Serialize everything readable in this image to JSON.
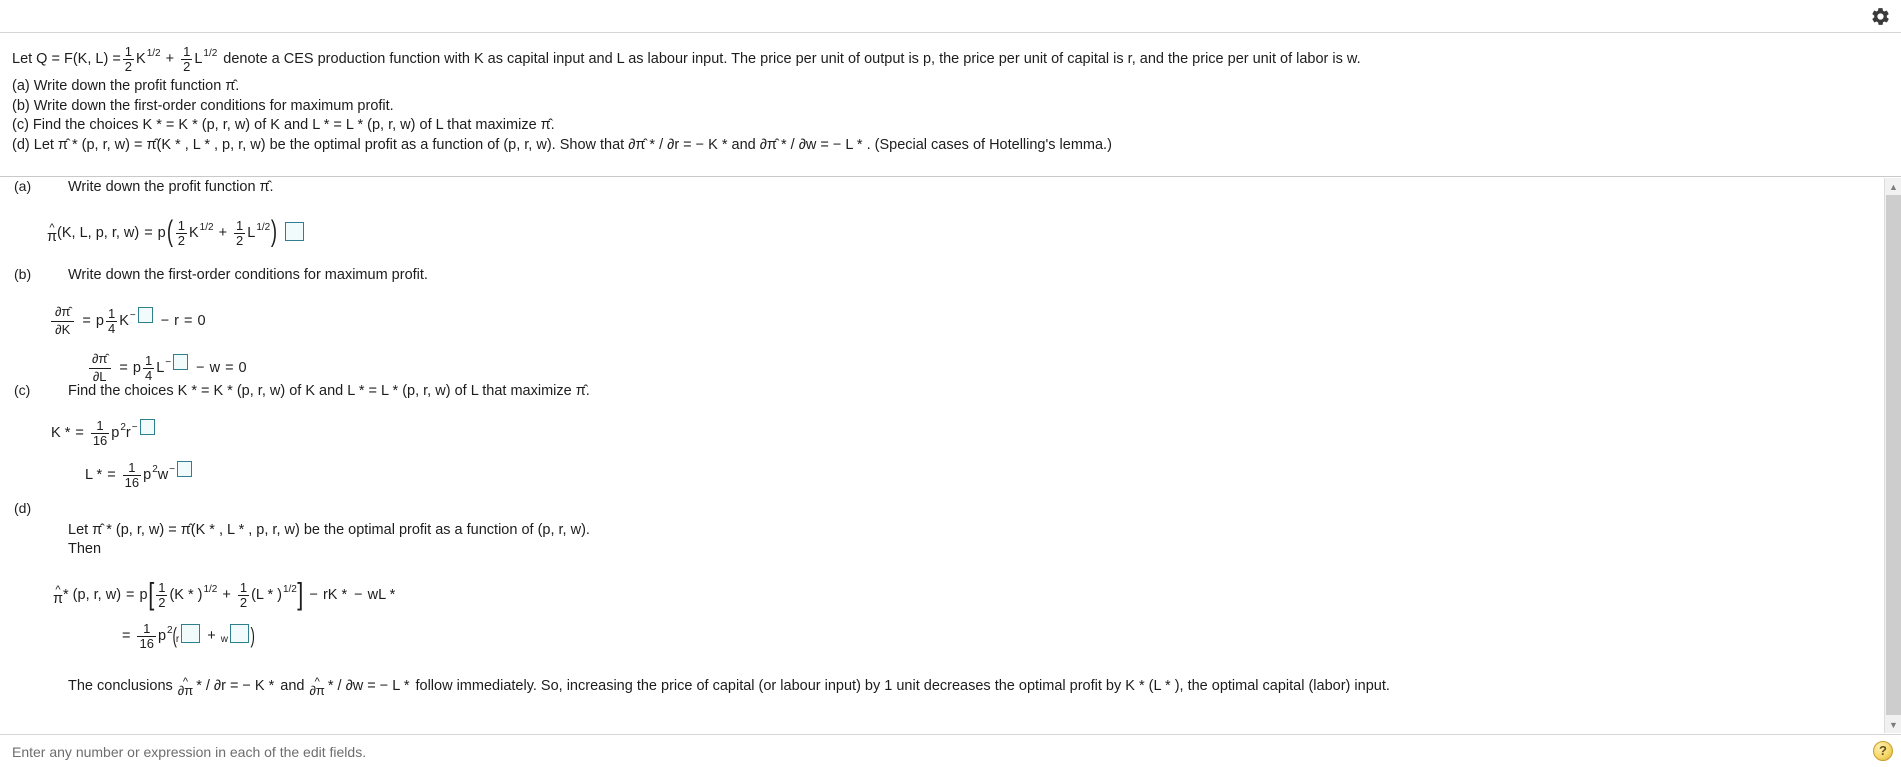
{
  "topbar": {
    "settings_icon": "gear-icon"
  },
  "statement": {
    "lead_prefix": "Let Q  =  F(K, L)  =",
    "lead_frac1_num": "1",
    "lead_frac1_den": "2",
    "lead_var1": "K",
    "lead_exp1": "1/2",
    "lead_plus": "+",
    "lead_frac2_num": "1",
    "lead_frac2_den": "2",
    "lead_var2": "L",
    "lead_exp2": "1/2",
    "lead_suffix": "denote a CES production function with K as capital input and L as labour input. The price per unit of output is p, the price per unit of capital is r, and the price per unit of labor is w.",
    "items": [
      "(a) Write down the profit function π̂.",
      "(b) Write down the first-order conditions for maximum profit.",
      "(c) Find the choices K *  = K * (p, r, w) of K and L *  = L * (p, r, w) of L that maximize π̂.",
      "(d) Let π̂ * (p, r, w) = π̂(K * , L * , p, r, w) be the optimal profit as a function of (p, r, w). Show that ∂π̂ * / ∂r  =  − K *  and ∂π̂ * / ∂w  =  − L * . (Special cases of Hotelling's lemma.)"
    ]
  },
  "parts": {
    "a": {
      "label": "(a)",
      "prompt": "Write down the profit function π̂.",
      "eq": {
        "lhs_pi": "π̂",
        "lhs_args": "(K, L, p, r, w)",
        "equals": "=",
        "p": "p",
        "open_paren": "(",
        "f1_num": "1",
        "f1_den": "2",
        "v1": "K",
        "e1": "1/2",
        "plus": "+",
        "f2_num": "1",
        "f2_den": "2",
        "v2": "L",
        "e2": "1/2",
        "close_paren": ")",
        "box_value": ""
      }
    },
    "b": {
      "label": "(b)",
      "prompt": "Write down the first-order conditions for maximum profit.",
      "eq1": {
        "dnum": "∂π̂",
        "dden": "∂K",
        "equals": "=",
        "p": "p",
        "f_num": "1",
        "f_den": "4",
        "v": "K",
        "minus_exp": "−",
        "box_value": "",
        "minus": "−",
        "term": "r",
        "equals2": "=",
        "zero": "0"
      },
      "eq2": {
        "dnum": "∂π̂",
        "dden": "∂L",
        "equals": "=",
        "p": "p",
        "f_num": "1",
        "f_den": "4",
        "v": "L",
        "minus_exp": "−",
        "box_value": "",
        "minus": "−",
        "term": "w",
        "equals2": "=",
        "zero": "0"
      }
    },
    "c": {
      "label": "(c)",
      "prompt": "Find the choices K *  = K * (p, r, w) of K and L *  = L * (p, r, w) of L that maximize π̂.",
      "eq1": {
        "lhs": "K *",
        "equals": "=",
        "f_num": "1",
        "f_den": "16",
        "p": "p",
        "p_exp": "2",
        "v": "r",
        "minus_exp": "−",
        "box_value": ""
      },
      "eq2": {
        "lhs": "L *",
        "equals": "=",
        "f_num": "1",
        "f_den": "16",
        "p": "p",
        "p_exp": "2",
        "v": "w",
        "minus_exp": "−",
        "box_value": ""
      }
    },
    "d": {
      "label": "(d)",
      "prompt_line1": "Let π̂ * (p, r, w) = π̂(K * , L * , p, r, w) be the optimal profit as a function of (p, r, w).",
      "prompt_line2": "Then",
      "eq1": {
        "lhs_pi": "π̂",
        "lhs_args": "* (p, r, w)",
        "equals": "=",
        "p": "p",
        "open_brack": "[",
        "f1_num": "1",
        "f1_den": "2",
        "t1": "(K * )",
        "e1": "1/2",
        "plus": "+",
        "f2_num": "1",
        "f2_den": "2",
        "t2": "(L * )",
        "e2": "1/2",
        "close_brack": "]",
        "minus1": "−",
        "term1": "rK *",
        "minus2": "−",
        "term2": "wL *"
      },
      "eq2": {
        "equals": "=",
        "f_num": "1",
        "f_den": "16",
        "p": "p",
        "p_exp": "2",
        "open_paren": "(",
        "v1": "r",
        "box1_value": "",
        "plus": "+",
        "v2": "w",
        "box2_value": "",
        "close_paren": ")"
      },
      "conclusion": {
        "seg1": "The conclusions",
        "d1_num": "∂π̂",
        "d1_rest": "* / ∂r  =  − K *",
        "seg2": "and",
        "d2_num": "∂π̂",
        "d2_rest": "* / ∂w  =  − L *",
        "seg3": "follow immediately. So, increasing the price of capital (or labour input) by 1 unit decreases the optimal profit by K * (L * ), the optimal capital (labor) input."
      }
    }
  },
  "scrollbar": {
    "up_arrow": "chevron-up-icon",
    "down_arrow": "chevron-down-icon"
  },
  "statusbar": {
    "message": "Enter any number or expression in each of the edit fields.",
    "help_label": "?"
  }
}
